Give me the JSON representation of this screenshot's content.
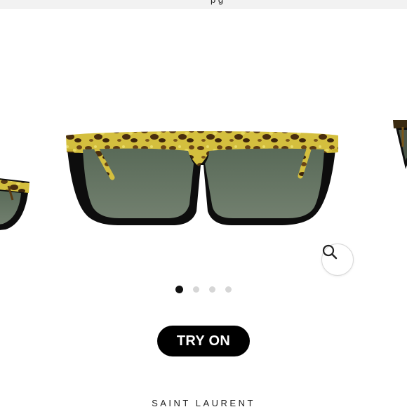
{
  "top_banner": {
    "text": "p     g"
  },
  "product": {
    "brand": "SAINT LAURENT",
    "try_on_label": "TRY ON"
  },
  "carousel": {
    "image_count": 4,
    "active_index": 0,
    "zoom_icon": "magnifier-icon"
  },
  "colors": {
    "frame_black": "#0d0d0d",
    "tortoise_yellow": "#d9c34a",
    "tortoise_brown": "#5a3a12",
    "lens_green": "#5f6f5f",
    "button_black": "#000000"
  }
}
